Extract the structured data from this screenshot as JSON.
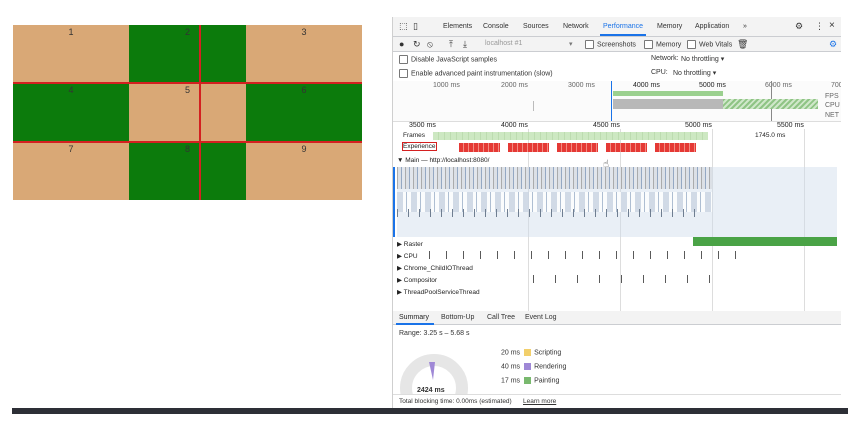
{
  "grid": {
    "cells": [
      {
        "label": "1",
        "color": "tan"
      },
      {
        "label": "2",
        "color": "green"
      },
      {
        "label": "3",
        "color": "tan"
      },
      {
        "label": "4",
        "color": "green"
      },
      {
        "label": "5",
        "color": "tan"
      },
      {
        "label": "6",
        "color": "green"
      },
      {
        "label": "7",
        "color": "tan"
      },
      {
        "label": "8",
        "color": "green"
      },
      {
        "label": "9",
        "color": "tan"
      }
    ],
    "colors": {
      "tan": "#d9a876",
      "green": "#0c7b0c",
      "border": "#d42020"
    }
  },
  "devtools": {
    "tabs": [
      "Elements",
      "Console",
      "Sources",
      "Network",
      "Performance",
      "Memory",
      "Application",
      "»"
    ],
    "active_tab": "Performance",
    "toolbar": {
      "url": "localhost #1",
      "screenshots": "Screenshots",
      "memory": "Memory",
      "web_vitals": "Web Vitals"
    },
    "settings": {
      "disable_js": "Disable JavaScript samples",
      "advanced_paint": "Enable advanced paint instrumentation (slow)",
      "network_label": "Network:",
      "network_value": "No throttling",
      "cpu_label": "CPU:",
      "cpu_value": "No throttling"
    },
    "overview": {
      "ticks": [
        "1000 ms",
        "2000 ms",
        "3000 ms",
        "4000 ms",
        "5000 ms",
        "6000 ms",
        "700"
      ],
      "lanes": [
        "FPS",
        "CPU",
        "NET"
      ]
    },
    "timeline": {
      "ticks": [
        "3500 ms",
        "4000 ms",
        "4500 ms",
        "5000 ms",
        "5500 ms"
      ],
      "frames_label": "Frames",
      "frame_time": "1745.0 ms",
      "experience_label": "Experience",
      "main_label": "▼ Main — http://localhost:8080/",
      "threads": [
        "▶ Raster",
        "▶ CPU",
        "▶ Chrome_ChildIOThread",
        "▶ Compositor",
        "▶ ThreadPoolServiceThread"
      ]
    },
    "bottom": {
      "tabs": [
        "Summary",
        "Bottom-Up",
        "Call Tree",
        "Event Log"
      ],
      "range": "Range: 3.25 s – 5.68 s",
      "total": "2424 ms",
      "legend": [
        {
          "value": "20 ms",
          "label": "Scripting",
          "color": "#f2cf6b"
        },
        {
          "value": "40 ms",
          "label": "Rendering",
          "color": "#9f88d6"
        },
        {
          "value": "17 ms",
          "label": "Painting",
          "color": "#79b96e"
        }
      ],
      "footer_text": "Total blocking time: 0.00ms (estimated)",
      "footer_link": "Learn more"
    }
  }
}
